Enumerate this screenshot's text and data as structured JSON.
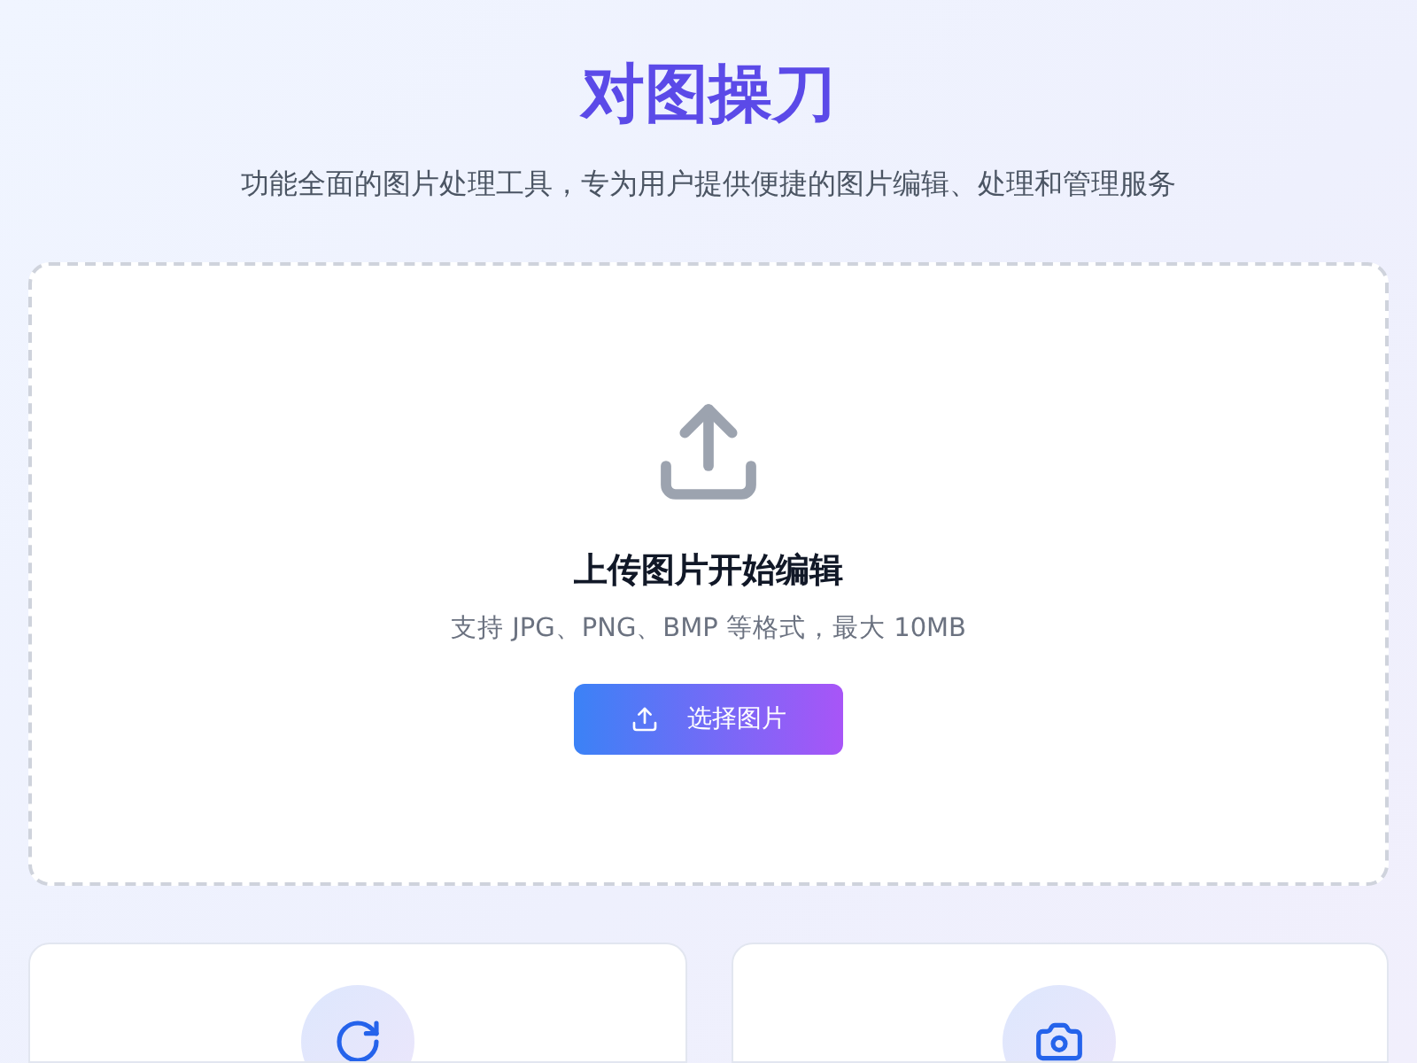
{
  "header": {
    "title": "对图操刀",
    "subtitle": "功能全面的图片处理工具，专为用户提供便捷的图片编辑、处理和管理服务"
  },
  "upload": {
    "heading": "上传图片开始编辑",
    "hint": "支持 JPG、PNG、BMP 等格式，最大 10MB",
    "button": "选择图片"
  },
  "features": [
    {
      "kind": "rotate"
    },
    {
      "kind": "camera"
    }
  ]
}
